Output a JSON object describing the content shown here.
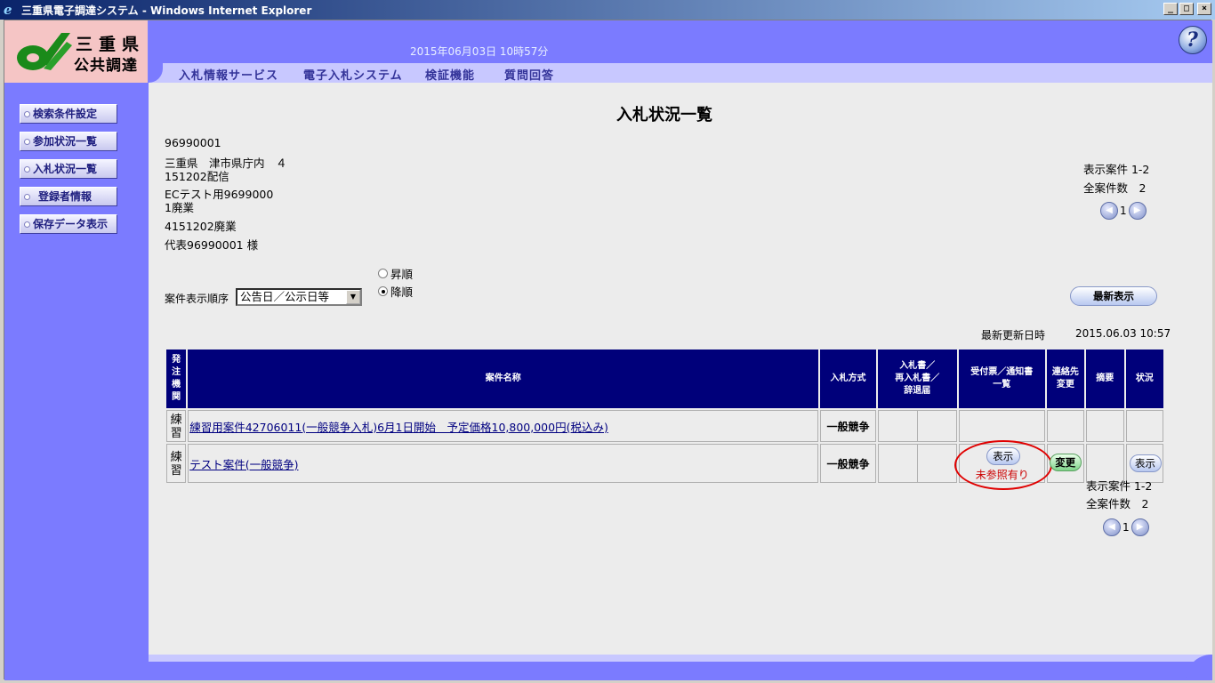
{
  "window": {
    "title": "三重県電子調達システム - Windows Internet Explorer",
    "icon": "ie-icon"
  },
  "header": {
    "logo_line1": "三重県",
    "logo_line2": "公共調達",
    "datetime": "2015年06月03日 10時57分"
  },
  "nav": {
    "items": [
      "入札情報サービス",
      "電子入札システム",
      "検証機能",
      "質問回答"
    ]
  },
  "sidebar": {
    "items": [
      "検索条件設定",
      "参加状況一覧",
      "入札状況一覧",
      "登録者情報",
      "保存データ表示"
    ]
  },
  "page": {
    "title": "入札状況一覧",
    "user_info": [
      "96990001",
      "三重県　津市県庁内　４",
      "151202配信",
      "ECテスト用9699000",
      "1廃業",
      "4151202廃業",
      "代表96990001 様"
    ]
  },
  "paging": {
    "display_label": "表示案件 1-2",
    "total_label": "全案件数　2",
    "current_page": "1"
  },
  "sort": {
    "label": "案件表示順序",
    "selected": "公告日／公示日等",
    "asc_label": "昇順",
    "desc_label": "降順",
    "selected_order": "desc"
  },
  "refresh_button": "最新表示",
  "last_update": {
    "label": "最新更新日時",
    "value": "2015.06.03 10:57"
  },
  "table": {
    "headers": [
      "発注機関",
      "案件名称",
      "入札方式",
      "入札書／再入札書／辞退届",
      "受付票／通知書一覧",
      "連絡先変更",
      "摘要",
      "状況"
    ],
    "rows": [
      {
        "org": "練習",
        "name": "練習用案件42706011(一般競争入札)6月1日開始　予定価格10,800,000円(税込み)",
        "method": "一般競争"
      },
      {
        "org": "練習",
        "name": "テスト案件(一般競争)",
        "method": "一般競争",
        "receipt_button": "表示",
        "receipt_status": "未参照有り",
        "contact_button": "変更",
        "status_button": "表示"
      }
    ]
  }
}
